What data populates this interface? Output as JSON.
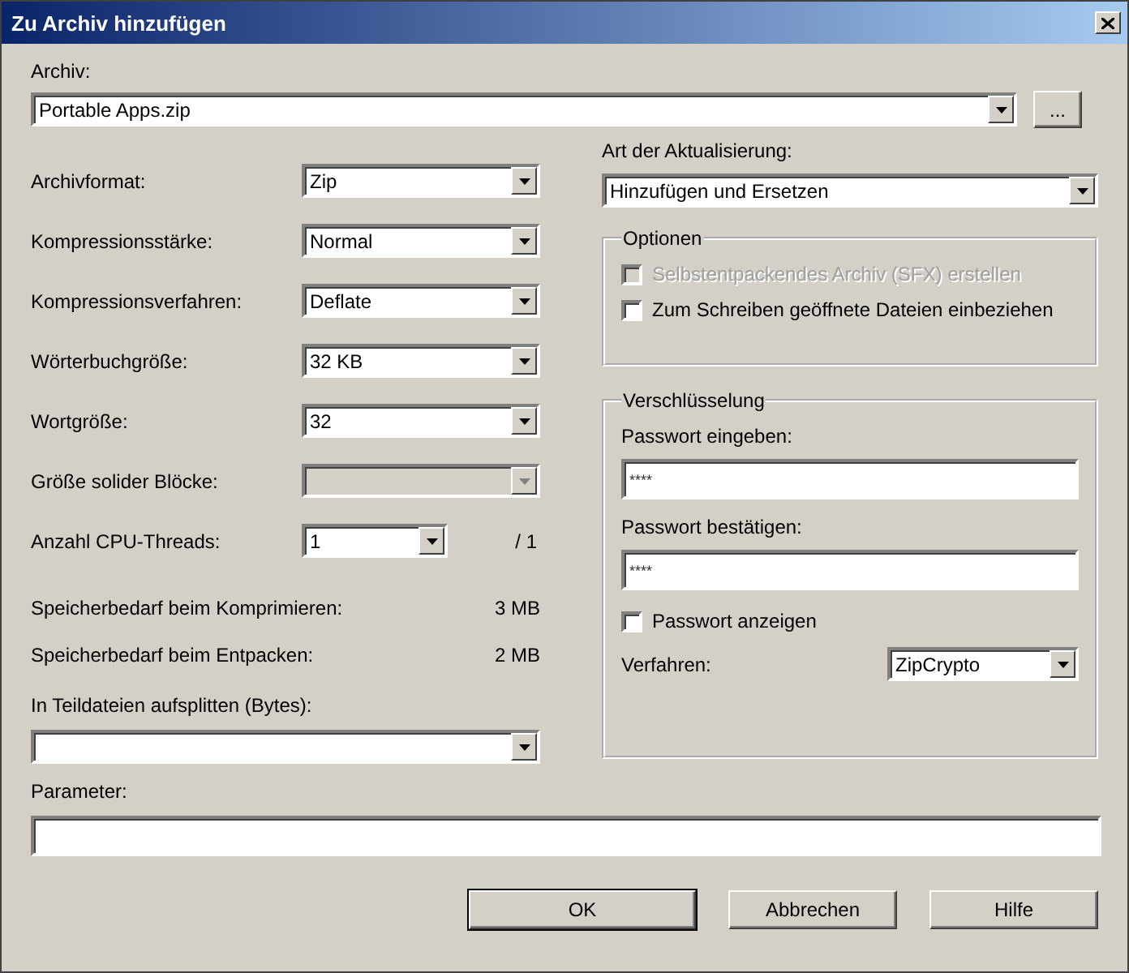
{
  "window": {
    "title": "Zu Archiv hinzufügen"
  },
  "archive": {
    "label": "Archiv:",
    "value": "Portable Apps.zip",
    "browse": "..."
  },
  "settings": [
    {
      "kind": "combo",
      "label": "Archivformat:",
      "value": "Zip",
      "disabled": false
    },
    {
      "kind": "combo",
      "label": "Kompressionsstärke:",
      "value": "Normal",
      "disabled": false
    },
    {
      "kind": "combo",
      "label": "Kompressionsverfahren:",
      "value": "Deflate",
      "disabled": false
    },
    {
      "kind": "combo",
      "label": "Wörterbuchgröße:",
      "value": "32 KB",
      "disabled": false
    },
    {
      "kind": "combo",
      "label": "Wortgröße:",
      "value": "32",
      "disabled": false
    },
    {
      "kind": "combo",
      "label": "Größe solider Blöcke:",
      "disabled": true
    },
    {
      "kind": "threads",
      "label": "Anzahl CPU-Threads:",
      "value": "1",
      "suffix": "/ 1",
      "disabled": false
    },
    {
      "kind": "info",
      "label": "Speicherbedarf beim Komprimieren:",
      "value": "3 MB"
    },
    {
      "kind": "info",
      "label": "Speicherbedarf beim Entpacken:",
      "value": "2 MB"
    }
  ],
  "split": {
    "label": "In Teildateien aufsplitten (Bytes):"
  },
  "update": {
    "label": "Art der Aktualisierung:",
    "value": "Hinzufügen und Ersetzen"
  },
  "options": {
    "title": "Optionen",
    "items": [
      {
        "label": "Selbstentpackendes Archiv (SFX) erstellen",
        "checked": false,
        "disabled": true
      },
      {
        "label": "Zum Schreiben geöffnete Dateien einbeziehen",
        "checked": false,
        "disabled": false
      }
    ]
  },
  "encryption": {
    "title": "Verschlüsselung",
    "password_label": "Passwort eingeben:",
    "password_value": "****",
    "confirm_label": "Passwort bestätigen:",
    "confirm_value": "****",
    "show_password": {
      "label": "Passwort anzeigen",
      "checked": false
    },
    "method": {
      "label": "Verfahren:",
      "value": "ZipCrypto"
    }
  },
  "parameter": {
    "label": "Parameter:"
  },
  "buttons": [
    {
      "label": "OK",
      "default": true
    },
    {
      "label": "Abbrechen",
      "default": false
    },
    {
      "label": "Hilfe",
      "default": false
    }
  ]
}
